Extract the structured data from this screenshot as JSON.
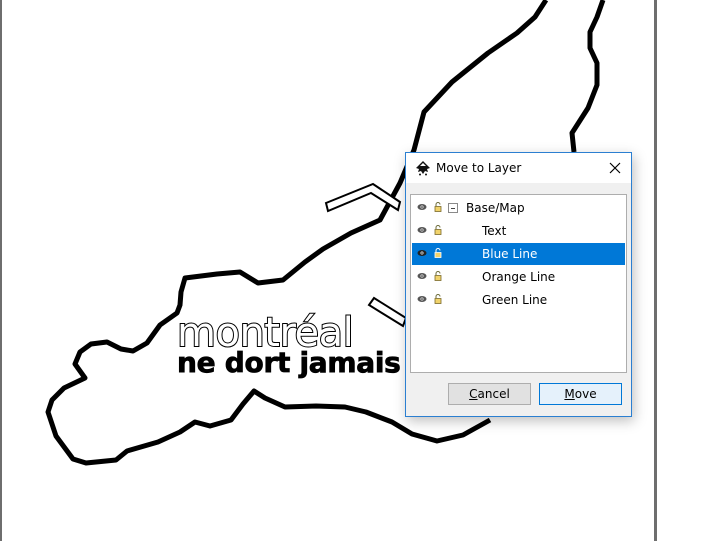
{
  "canvas": {
    "map_text_line1": "montréal",
    "map_text_line2": "ne dort jamais",
    "outline_color": "#000000",
    "page_border_color": "#6e6e6e"
  },
  "dialog": {
    "title": "Move to Layer",
    "app_icon": "inkscape-icon",
    "close_icon": "close-icon",
    "layers": [
      {
        "label": "Base/Map",
        "level": 0,
        "expanded": true,
        "visible": true,
        "locked": false,
        "selected": false
      },
      {
        "label": "Text",
        "level": 1,
        "visible": true,
        "locked": false,
        "selected": false
      },
      {
        "label": "Blue Line",
        "level": 1,
        "visible": true,
        "locked": false,
        "selected": true
      },
      {
        "label": "Orange Line",
        "level": 1,
        "visible": true,
        "locked": false,
        "selected": false
      },
      {
        "label": "Green Line",
        "level": 1,
        "visible": true,
        "locked": false,
        "selected": false
      }
    ],
    "buttons": {
      "cancel_mnemonic": "C",
      "cancel_rest": "ancel",
      "move_mnemonic": "M",
      "move_rest": "ove"
    },
    "accent_color": "#0078d7"
  }
}
